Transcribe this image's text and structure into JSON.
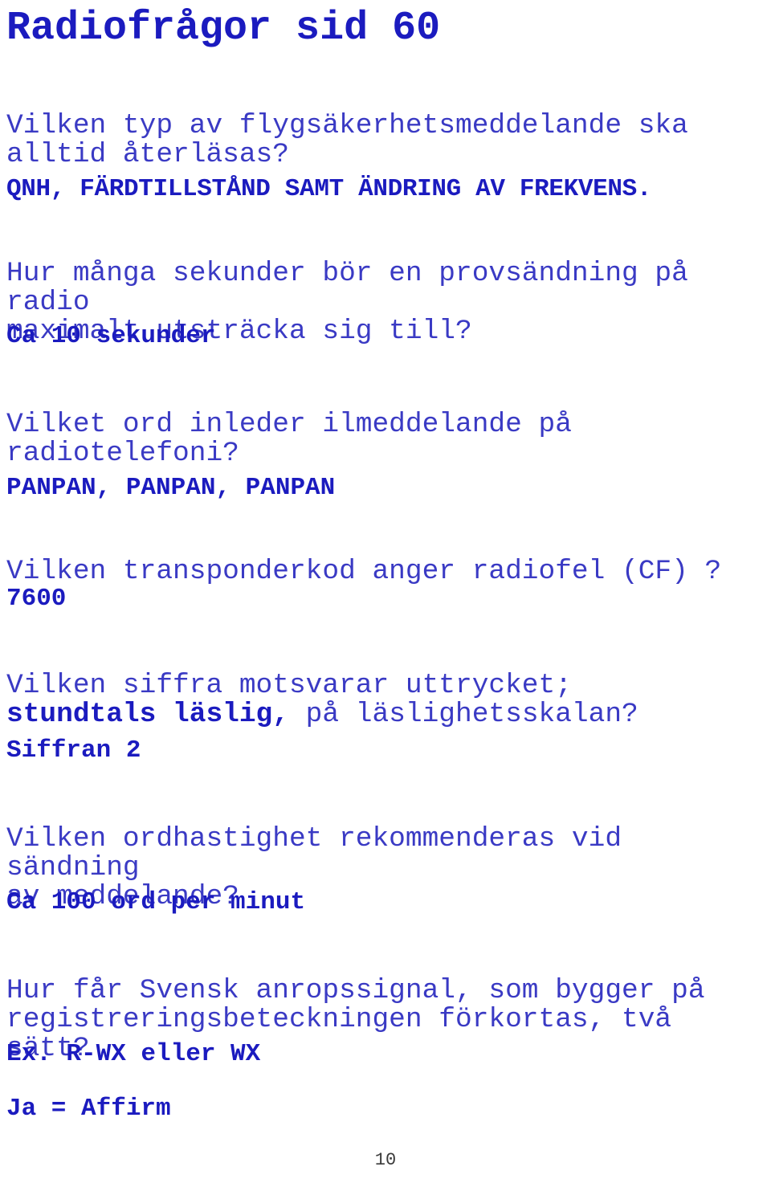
{
  "document": {
    "title": "Radiofrågor sid 60",
    "page_number": "10",
    "text_color": "#1b1bbf",
    "question_color": "#3a3ac4",
    "page_number_color": "#3a3a3a",
    "background_color": "#ffffff"
  },
  "items": [
    {
      "question_line1": "Vilken typ av flygsäkerhetsmeddelande ska",
      "question_line2": "alltid återläsas?",
      "answer": "QNH, FÄRDTILLSTÅND SAMT ÄNDRING AV FREKVENS."
    },
    {
      "question_line1": "Hur många sekunder bör en provsändning på radio",
      "question_line2": "maximalt utsträcka sig till?",
      "answer": "Ca 10 sekunder"
    },
    {
      "question_line1": "Vilket ord inleder ilmeddelande på",
      "question_line2": "radiotelefoni?",
      "answer": "PANPAN, PANPAN, PANPAN"
    },
    {
      "question_line1": "Vilken transponderkod anger radiofel (CF) ?",
      "question_line2": "",
      "answer": "7600"
    },
    {
      "question_line1": "Vilken siffra motsvarar uttrycket;",
      "question_emphasis": "stundtals läslig,",
      "question_line2_rest": " på läslighetsskalan?",
      "answer": "Siffran 2"
    },
    {
      "question_line1": "Vilken ordhastighet rekommenderas vid sändning",
      "question_line2": "av meddelande?",
      "answer": "Ca 100 ord per minut"
    },
    {
      "question_line1": "Hur får Svensk anropssignal, som bygger på",
      "question_line2": "registreringsbeteckningen förkortas, två sätt?",
      "answer": "Ex. R-WX eller WX"
    },
    {
      "answer_only": "Ja = Affirm"
    }
  ]
}
